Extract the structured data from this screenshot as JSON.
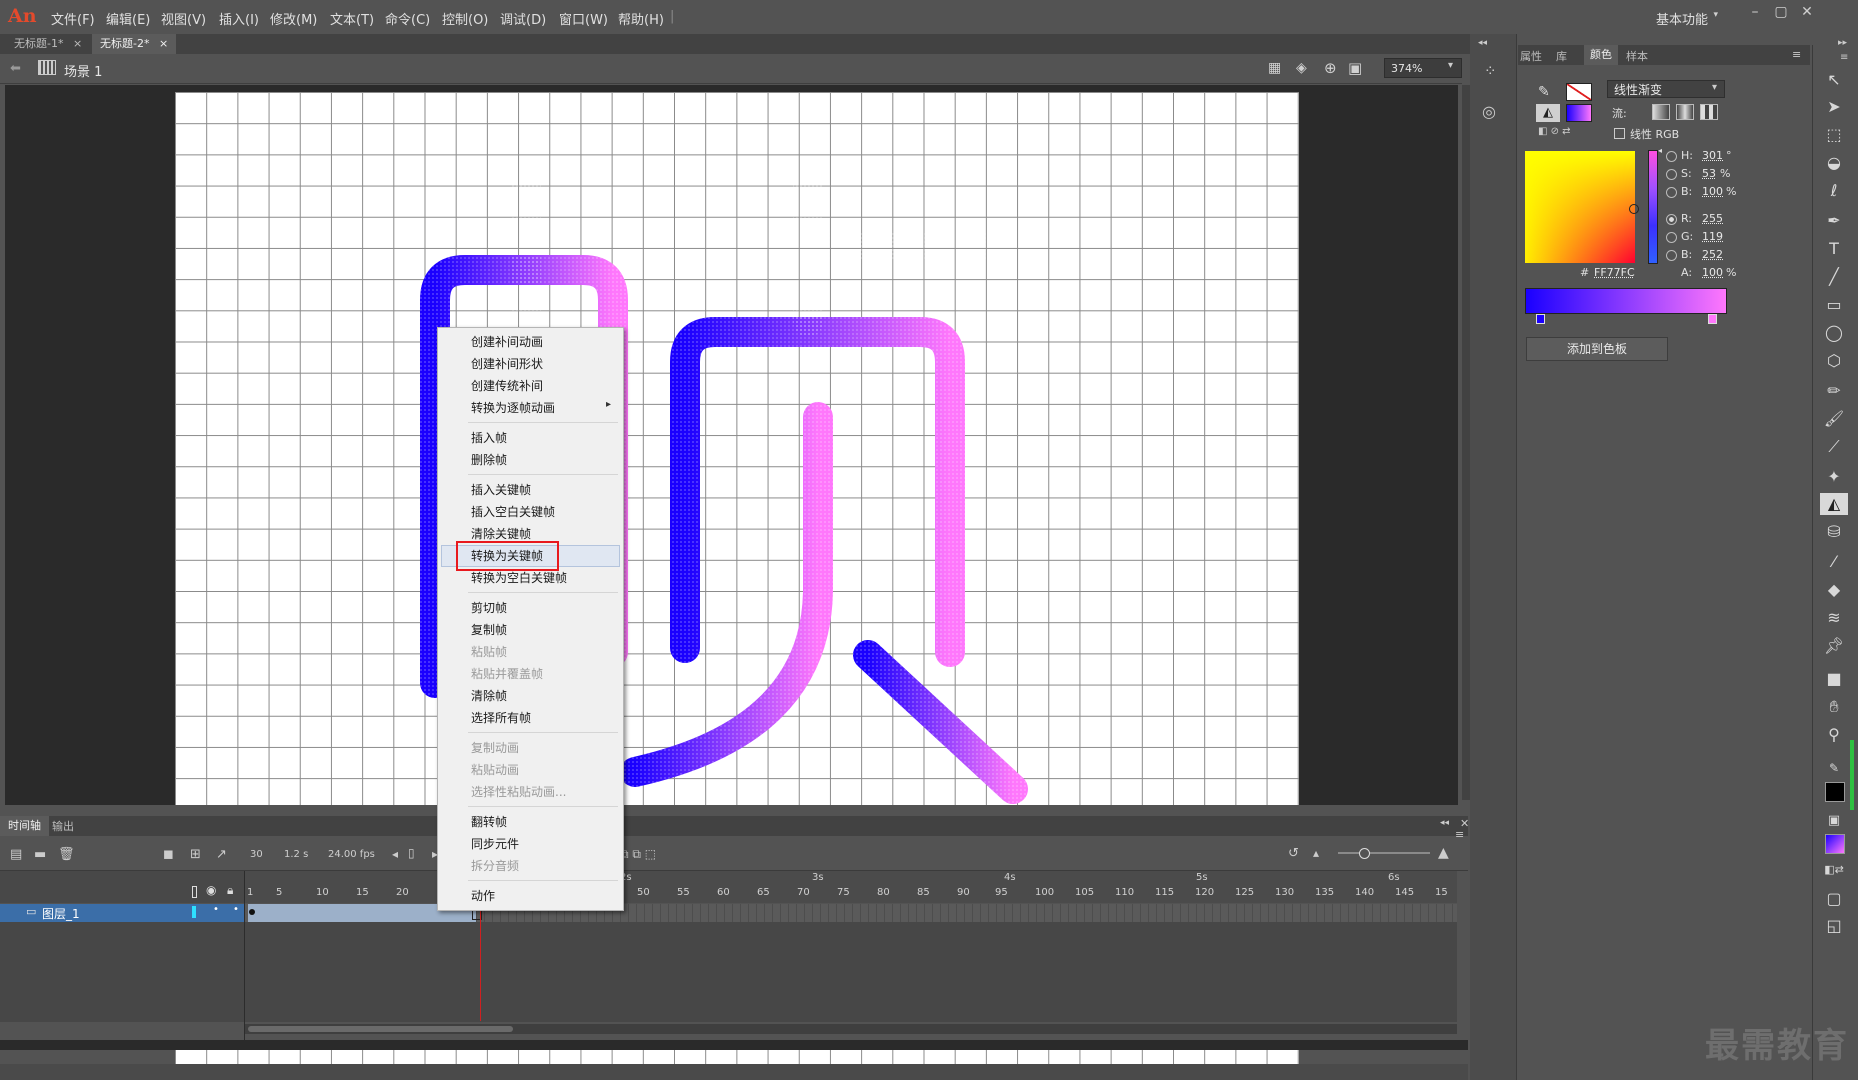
{
  "app": {
    "logo": "An",
    "workspace": "基本功能"
  },
  "menu": [
    "文件(F)",
    "编辑(E)",
    "视图(V)",
    "插入(I)",
    "修改(M)",
    "文本(T)",
    "命令(C)",
    "控制(O)",
    "调试(D)",
    "窗口(W)",
    "帮助(H)"
  ],
  "tabs": [
    {
      "label": "无标题-1*",
      "close": "×"
    },
    {
      "label": "无标题-2*",
      "close": "×"
    }
  ],
  "scene": {
    "label": "场景 1",
    "zoom": "374%"
  },
  "context_menu": {
    "items": [
      {
        "label": "创建补间动画",
        "disabled": false
      },
      {
        "label": "创建补间形状",
        "disabled": false
      },
      {
        "label": "创建传统补间",
        "disabled": false
      },
      {
        "label": "转换为逐帧动画",
        "disabled": false,
        "submenu": true
      },
      {
        "label": "插入帧",
        "disabled": false
      },
      {
        "label": "删除帧",
        "disabled": false
      },
      {
        "label": "插入关键帧",
        "disabled": false
      },
      {
        "label": "插入空白关键帧",
        "disabled": false
      },
      {
        "label": "清除关键帧",
        "disabled": false
      },
      {
        "label": "转换为关键帧",
        "disabled": false,
        "highlighted": true
      },
      {
        "label": "转换为空白关键帧",
        "disabled": false
      },
      {
        "label": "剪切帧",
        "disabled": false
      },
      {
        "label": "复制帧",
        "disabled": false
      },
      {
        "label": "粘贴帧",
        "disabled": true
      },
      {
        "label": "粘贴并覆盖帧",
        "disabled": true
      },
      {
        "label": "清除帧",
        "disabled": false
      },
      {
        "label": "选择所有帧",
        "disabled": false
      },
      {
        "label": "复制动画",
        "disabled": true
      },
      {
        "label": "粘贴动画",
        "disabled": true
      },
      {
        "label": "选择性粘贴动画...",
        "disabled": true
      },
      {
        "label": "翻转帧",
        "disabled": false
      },
      {
        "label": "同步元件",
        "disabled": false
      },
      {
        "label": "拆分音频",
        "disabled": true
      },
      {
        "label": "动作",
        "disabled": false
      }
    ],
    "submenu_arrow": "▸"
  },
  "timeline": {
    "tabs": [
      "时间轴",
      "输出"
    ],
    "fps_frame": "30",
    "time": "1.2 s",
    "fps": "24.00 fps",
    "layer_name": "图层_1",
    "frame_numbers": [
      "1",
      "5",
      "10",
      "15",
      "20",
      "50",
      "55",
      "60",
      "65",
      "70",
      "75",
      "80",
      "85",
      "90",
      "95",
      "100",
      "105",
      "110",
      "115",
      "120",
      "125",
      "130",
      "135",
      "140",
      "145",
      "15"
    ],
    "seconds": [
      "2s",
      "3s",
      "4s",
      "5s",
      "6s"
    ]
  },
  "color_panel": {
    "tabs": [
      "属性",
      "库",
      "颜色",
      "样本"
    ],
    "fill_type": "线性渐变",
    "flow_label": "流:",
    "linear_rgb": "线性 RGB",
    "hsb": [
      {
        "label": "H:",
        "value": "301",
        "unit": "°"
      },
      {
        "label": "S:",
        "value": "53",
        "unit": "%"
      },
      {
        "label": "B:",
        "value": "100",
        "unit": "%"
      }
    ],
    "rgb": [
      {
        "label": "R:",
        "value": "255"
      },
      {
        "label": "G:",
        "value": "119"
      },
      {
        "label": "B:",
        "value": "252"
      }
    ],
    "hex_label": "#",
    "hex": "FF77FC",
    "alpha_label": "A:",
    "alpha": "100",
    "alpha_unit": "%",
    "add_swatch": "添加到色板",
    "gradient_start": "#1a00ff",
    "gradient_end": "#ff77fc"
  },
  "watermark": "最需教育"
}
